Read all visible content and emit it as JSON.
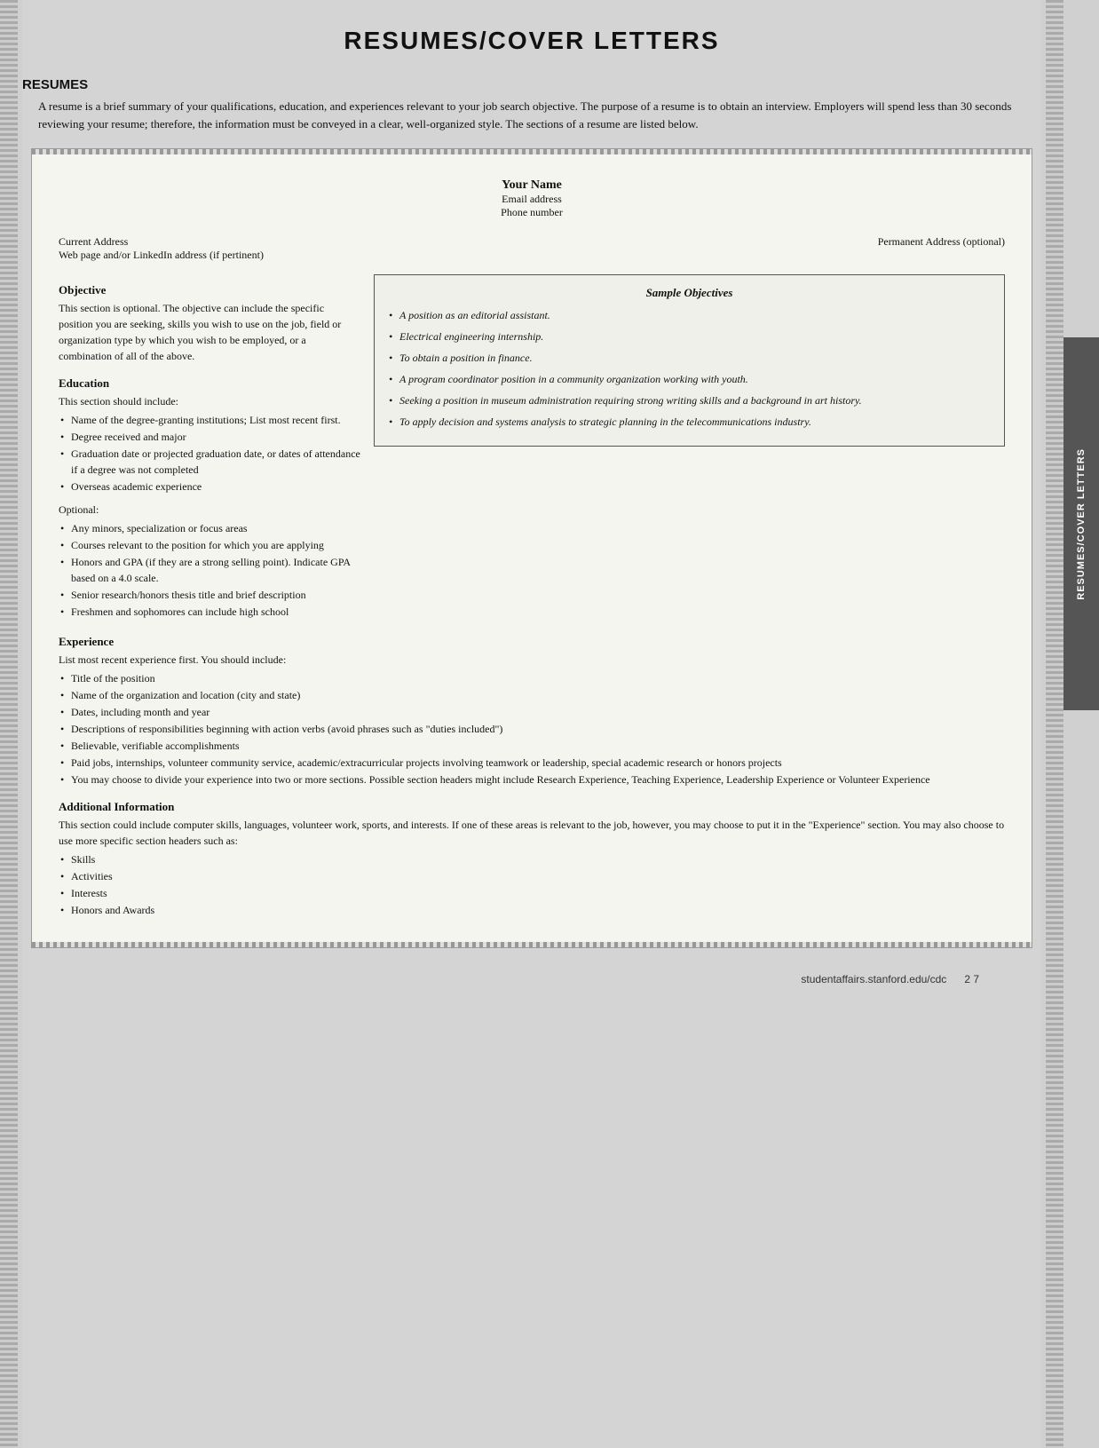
{
  "page": {
    "title": "RESUMES/COVER LETTERS",
    "footer_url": "studentaffairs.stanford.edu/cdc",
    "footer_page": "2 7"
  },
  "side_tab": {
    "label": "RESUMES/COVER LETTERS"
  },
  "resumes_section": {
    "heading": "RESUMES",
    "intro": "A resume is a brief summary of your qualifications, education, and experiences relevant to your job search objective. The purpose of a resume is to obtain an interview. Employers will spend less than 30 seconds reviewing your resume; therefore, the information must be conveyed in a clear, well-organized style. The sections of a resume are listed below."
  },
  "resume_doc": {
    "header": {
      "name": "Your Name",
      "email": "Email address",
      "phone": "Phone number"
    },
    "address": {
      "current": "Current Address",
      "web": "Web page and/or LinkedIn address (if pertinent)",
      "permanent": "Permanent Address (optional)"
    },
    "objective": {
      "title": "Objective",
      "text": "This section is optional. The objective can include the specific position you are seeking, skills you wish to use on the job, field or organization type by which you wish to be employed, or a combination of all of the above."
    },
    "sample_objectives": {
      "title": "Sample Objectives",
      "items": [
        "A position as an editorial assistant.",
        "Electrical engineering internship.",
        "To obtain a position in finance.",
        "A program coordinator position in a community organization working with youth.",
        "Seeking a position in museum administration requiring strong writing skills and a background in art history.",
        "To apply decision and systems analysis to strategic planning in the telecommunications industry."
      ]
    },
    "education": {
      "title": "Education",
      "intro": "This section should include:",
      "required_items": [
        "Name of the degree-granting institutions; List most recent first.",
        "Degree received and major",
        "Graduation date or projected graduation date, or dates of attendance if a degree was not completed",
        "Overseas academic experience"
      ],
      "optional_label": "Optional:",
      "optional_items": [
        "Any minors, specialization or focus areas",
        "Courses relevant to the position for which you are applying",
        "Honors and GPA (if they are a strong selling point). Indicate GPA based on a 4.0 scale.",
        "Senior research/honors thesis title and brief description",
        "Freshmen and sophomores can include high school"
      ]
    },
    "experience": {
      "title": "Experience",
      "intro": "List most recent experience first. You should include:",
      "items": [
        "Title of the position",
        "Name of the organization and location (city and state)",
        "Dates, including month and year",
        "Descriptions of responsibilities beginning with action verbs (avoid phrases such as \"duties included\")",
        "Believable, verifiable accomplishments",
        "Paid jobs, internships, volunteer community service, academic/extracurricular projects involving teamwork or leadership, special academic research or honors projects",
        "You may choose to divide your experience into two or more sections. Possible section headers might include Research Experience, Teaching Experience, Leadership Experience or Volunteer Experience"
      ]
    },
    "additional_info": {
      "title": "Additional Information",
      "text": "This section could include computer skills, languages, volunteer work, sports, and interests. If one of these areas is relevant to the job, however, you may choose to put it in the \"Experience\" section. You may also choose to use more specific section headers such as:",
      "items": [
        "Skills",
        "Activities",
        "Interests",
        "Honors and Awards"
      ]
    }
  }
}
